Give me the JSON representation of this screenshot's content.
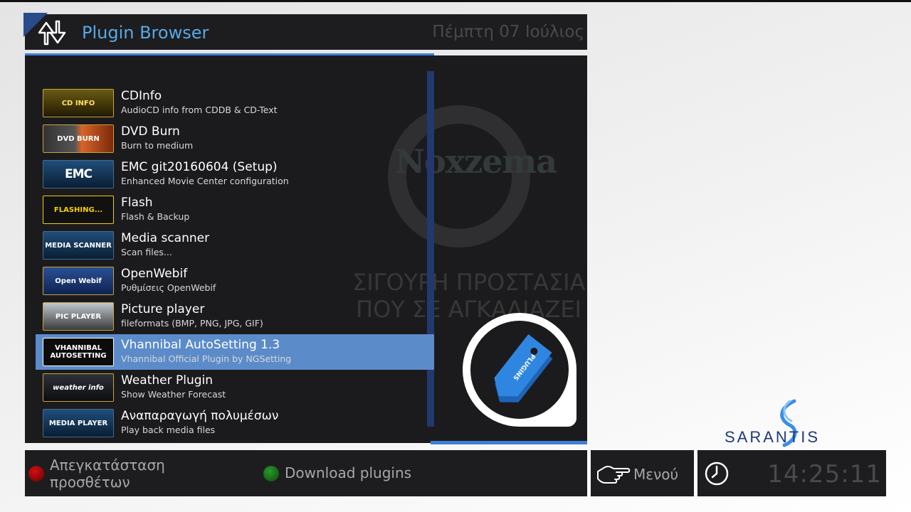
{
  "header": {
    "title": "Plugin Browser",
    "date": "Πέμπτη 07 Ιούλιος"
  },
  "plugins": [
    {
      "name": "CDInfo",
      "desc": "AudioCD info from CDDB & CD-Text",
      "thumb_label": "CD INFO",
      "icon": "cd-info-icon"
    },
    {
      "name": "DVD Burn",
      "desc": "Burn to medium",
      "thumb_label": "DVD BURN",
      "icon": "dvd-burn-icon"
    },
    {
      "name": "EMC git20160604 (Setup)",
      "desc": "Enhanced Movie Center configuration",
      "thumb_label": "EMC",
      "icon": "emc-camera-icon"
    },
    {
      "name": "Flash",
      "desc": "Flash & Backup",
      "thumb_label": "FLASHING...",
      "icon": "flash-icon"
    },
    {
      "name": "Media scanner",
      "desc": "Scan files...",
      "thumb_label": "MEDIA SCANNER",
      "icon": "media-scanner-icon"
    },
    {
      "name": "OpenWebif",
      "desc": "Ρυθμίσεις OpenWebif",
      "thumb_label": "Open Webif",
      "icon": "openwebif-icon"
    },
    {
      "name": "Picture player",
      "desc": "fileformats (BMP, PNG, JPG, GIF)",
      "thumb_label": "PIC PLAYER",
      "icon": "picture-player-icon"
    },
    {
      "name": "Vhannibal AutoSetting 1.3",
      "desc": "Vhannibal Official Plugin by NGSetting",
      "thumb_label": "VHANNIBAL AUTOSETTING",
      "icon": "vhannibal-icon",
      "selected": true
    },
    {
      "name": "Weather Plugin",
      "desc": "Show Weather Forecast",
      "thumb_label": "weather info",
      "icon": "weather-icon"
    },
    {
      "name": "Αναπαραγωγή πολυμέσων",
      "desc": "Play back media files",
      "thumb_label": "MEDIA PLAYER",
      "icon": "media-player-icon"
    }
  ],
  "watermark": {
    "brand": "Noxzema",
    "line1": "ΣΙΓΟΥΡΗ ΠΡΟΣΤΑΣΙΑ",
    "line2": "ΠΟΥ ΣΕ ΑΓΚΑΛΙΑΖΕΙ"
  },
  "badge": {
    "label": "PLUGINS"
  },
  "buttons": {
    "red_label": "Απεγκατάσταση προσθέτων",
    "green_label": "Download plugins",
    "menu_label": "Μενού"
  },
  "clock": {
    "time": "14:25:11"
  },
  "sponsor": {
    "name": "SARANTIS"
  },
  "colors": {
    "accent_blue": "#3d7fd8",
    "title_blue": "#5aa8e6",
    "selected_row": "#5b8bc9",
    "panel_bg": "#1b1b1d"
  }
}
